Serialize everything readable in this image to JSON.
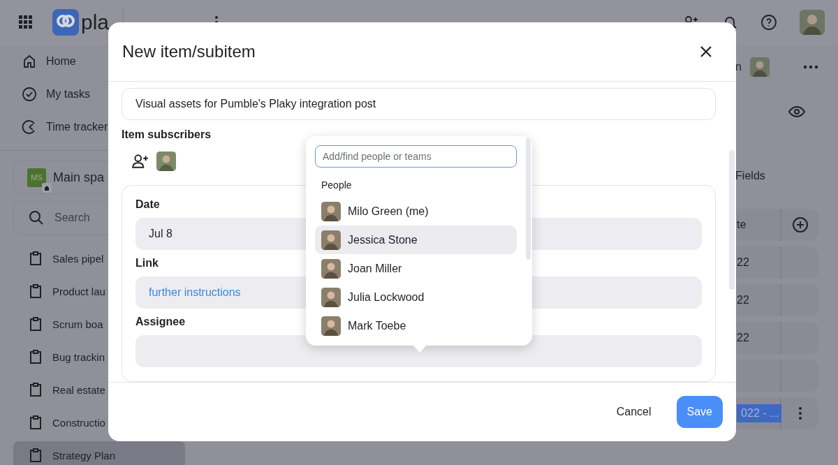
{
  "topbar": {
    "logo_text": "pla"
  },
  "sidebar": {
    "nav": [
      {
        "label": "Home"
      },
      {
        "label": "My tasks"
      },
      {
        "label": "Time tracker"
      }
    ],
    "space": {
      "initials": "MS",
      "name": "Main spa"
    },
    "search": {
      "placeholder": "Search"
    },
    "boards": [
      {
        "label": "Sales pipel",
        "selected": false
      },
      {
        "label": "Product lau",
        "selected": false
      },
      {
        "label": "Scrum boa",
        "selected": false
      },
      {
        "label": "Bug trackin",
        "selected": false
      },
      {
        "label": "Real estate",
        "selected": false
      },
      {
        "label": "Constructio",
        "selected": false
      },
      {
        "label": "Strategy Plan",
        "selected": true
      }
    ]
  },
  "main": {
    "header_text": "n",
    "fields_label": "Fields",
    "rows": [
      {
        "kind": "header",
        "text": "te"
      },
      {
        "kind": "row",
        "text": "22"
      },
      {
        "kind": "row",
        "text": "22"
      },
      {
        "kind": "row",
        "text": "22"
      },
      {
        "kind": "empty"
      },
      {
        "kind": "highlight",
        "text": "022 - ..."
      }
    ]
  },
  "modal": {
    "title": "New item/subitem",
    "name_value": "Visual assets for Pumble's Plaky integration post",
    "subscribers_label": "Item subscribers",
    "fields": [
      {
        "label": "Date",
        "kind": "text",
        "value": "Jul 8"
      },
      {
        "label": "Link",
        "kind": "link",
        "value": "further instructions"
      },
      {
        "label": "Assignee",
        "kind": "empty"
      }
    ],
    "cancel": "Cancel",
    "save": "Save"
  },
  "people_dropdown": {
    "placeholder": "Add/find people or teams",
    "section": "People",
    "people": [
      {
        "name": "Milo Green (me)",
        "selected": false
      },
      {
        "name": "Jessica Stone",
        "selected": true
      },
      {
        "name": "Joan Miller",
        "selected": false
      },
      {
        "name": "Julia Lockwood",
        "selected": false
      },
      {
        "name": "Mark Toebe",
        "selected": false
      }
    ]
  }
}
